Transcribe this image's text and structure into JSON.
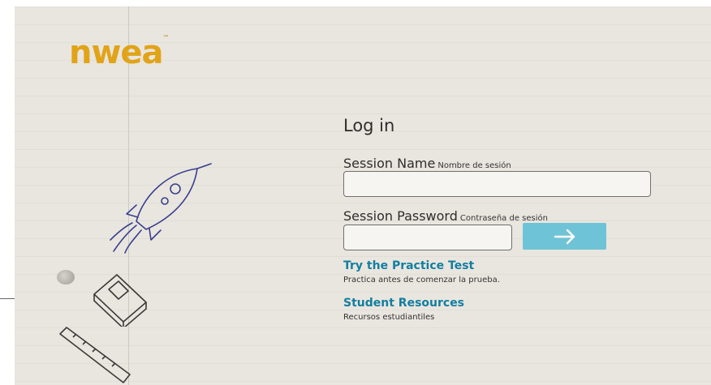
{
  "brand": {
    "logo_text": "nwea",
    "logo_color": "#e1a318"
  },
  "login": {
    "title": "Log in",
    "session_name_label": "Session Name",
    "session_name_sublabel": "Nombre de sesión",
    "session_name_value": "",
    "session_password_label": "Session Password",
    "session_password_sublabel": "Contraseña de sesión",
    "session_password_value": "",
    "submit_icon": "arrow-right-icon",
    "submit_color": "#6fc3d6"
  },
  "links": {
    "practice_title": "Try the Practice Test",
    "practice_desc": "Practica antes de comenzar la prueba.",
    "resources_title": "Student Resources",
    "resources_desc": "Recursos estudiantiles",
    "link_color": "#137ea0"
  },
  "decorations": [
    "rocket-doodle",
    "book-doodle",
    "ruler-doodle"
  ]
}
